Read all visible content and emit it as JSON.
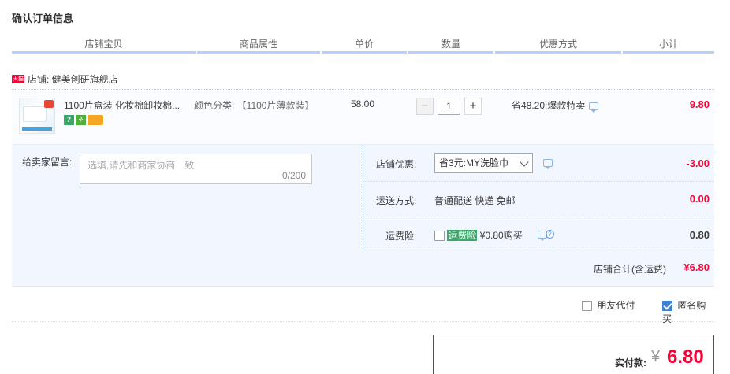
{
  "page_title": "确认订单信息",
  "table_header": [
    "店铺宝贝",
    "商品属性",
    "单价",
    "数量",
    "优惠方式",
    "小计"
  ],
  "shop": {
    "badge": "天猫",
    "name": "店铺: 健美创研旗舰店"
  },
  "item": {
    "name": "1100片盒装 化妆棉卸妆棉...",
    "attr": "颜色分类: 【1100片薄款装】",
    "price": "58.00",
    "qty": "1",
    "qty_minus": "−",
    "qty_plus": "+",
    "promo": "省48.20:爆款特卖",
    "subtotal": "9.80",
    "icons": [
      "7",
      "⚘",
      ""
    ]
  },
  "message": {
    "label": "给卖家留言:",
    "placeholder": "选填,请先和商家协商一致",
    "count": "0/200"
  },
  "store_discount": {
    "label": "店铺优惠:",
    "selected": "省3元:MY洗脸巾",
    "value": "-3.00"
  },
  "shipping": {
    "label": "运送方式:",
    "method": "普通配送 快递 免邮",
    "value": "0.00"
  },
  "insurance": {
    "label": "运费险:",
    "highlight": "运费险",
    "text": "¥0.80购买",
    "help": "?",
    "value": "0.80"
  },
  "store_total": {
    "label": "店铺合计(含运费)",
    "value": "¥6.80"
  },
  "options": {
    "friend_pay": "朋友代付",
    "anonymous": "匿名购买"
  },
  "payment": {
    "label": "实付款:",
    "currency": "¥",
    "value": "6.80"
  },
  "colors": {
    "accent_red": "#ff0036",
    "header_line": "#b2d1ff",
    "panel_bg": "#f2f7ff"
  }
}
